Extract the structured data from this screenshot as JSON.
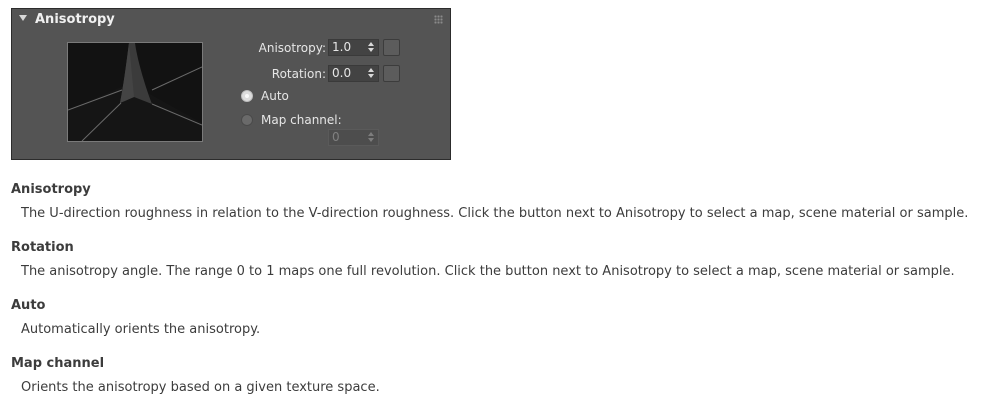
{
  "rollout": {
    "title": "Anisotropy",
    "anisotropy": {
      "label": "Anisotropy:",
      "value": "1.0"
    },
    "rotation": {
      "label": "Rotation:",
      "value": "0.0"
    },
    "orientation_options": [
      {
        "label": "Auto",
        "selected": true
      },
      {
        "label": "Map channel:",
        "selected": false
      }
    ],
    "map_channel_value": "0"
  },
  "docs": [
    {
      "term": "Anisotropy",
      "description": "The U-direction roughness in relation to the V-direction roughness. Click the button next to Anisotropy to select a map, scene material or sample."
    },
    {
      "term": "Rotation",
      "description": "The anisotropy angle. The range 0 to 1 maps one full revolution. Click the button next to Anisotropy to select a map, scene material or sample."
    },
    {
      "term": "Auto",
      "description": "Automatically orients the anisotropy."
    },
    {
      "term": "Map channel",
      "description": "Orients the anisotropy based on a given texture space."
    }
  ],
  "colors": {
    "panel_bg": "#545454",
    "field_bg": "#434343",
    "text_light": "#e6e6e6",
    "doc_text": "#3c3c3c"
  },
  "icons": [
    "collapse-arrow-icon",
    "grip-icon",
    "spinner-up-icon",
    "spinner-down-icon"
  ]
}
